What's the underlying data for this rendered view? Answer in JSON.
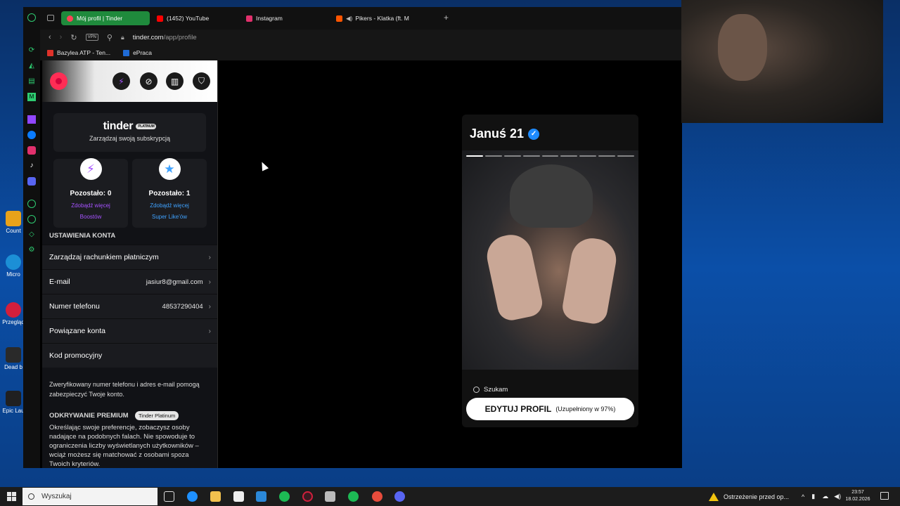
{
  "browser": {
    "tabs": [
      {
        "label": "Mój profil | Tinder",
        "active": true,
        "icon": "tinder-flame-icon",
        "color": "#ff4458"
      },
      {
        "label": "(1452) YouTube",
        "active": false,
        "icon": "youtube-icon",
        "color": "#ff0000"
      },
      {
        "label": "Instagram",
        "active": false,
        "icon": "instagram-icon",
        "color": "#e1306c"
      },
      {
        "label": "Pikers - Klatka (ft. M",
        "active": false,
        "icon": "soundcloud-icon",
        "color": "#ff5500"
      }
    ],
    "vpn_label": "VPN",
    "url_host": "tinder.com",
    "url_path": "/app/profile",
    "bookmarks": [
      {
        "label": "Bazylea ATP - Ten...",
        "icon": "bazylea-icon",
        "color": "#e0322a"
      },
      {
        "label": "ePraca",
        "icon": "epraca-icon",
        "color": "#1f6bd6"
      }
    ]
  },
  "tinder": {
    "logo_text": "tinder",
    "platinum_badge": "PLATINUM",
    "manage_subscription": "Zarządzaj swoją subskrypcją",
    "boosts": {
      "remaining": "Pozostało: 0",
      "link1": "Zdobądź więcej",
      "link2": "Boostów",
      "color": "#a652ff"
    },
    "superlikes": {
      "remaining": "Pozostało: 1",
      "link1": "Zdobądź więcej",
      "link2": "Super Like'ów",
      "color": "#3fa2ff"
    },
    "section_title": "USTAWIENIA KONTA",
    "rows": [
      {
        "label": "Zarządzaj rachunkiem płatniczym",
        "value": ""
      },
      {
        "label": "E-mail",
        "value": "jasiur8@gmail.com"
      },
      {
        "label": "Numer telefonu",
        "value": "48537290404"
      },
      {
        "label": "Powiązane konta",
        "value": ""
      },
      {
        "label": "Kod promocyjny",
        "value": ""
      }
    ],
    "note": "Zweryfikowany numer telefonu i adres e-mail pomogą zabezpieczyć Twoje konto.",
    "premium_title": "ODKRYWANIE PREMIUM",
    "premium_badge": "Tinder Platinum",
    "premium_text": "Określając swoje preferencje, zobaczysz osoby nadające na podobnych falach. Nie spowoduje to ograniczenia liczby wyświetlanych użytkowników – wciąż możesz się matchować z osobami spoza Twoich kryteriów."
  },
  "profile": {
    "name_age": "Januś 21",
    "photo_count": 9,
    "active_photo": 1,
    "seeking_label": "Szukam",
    "edit_label": "EDYTUJ PROFIL",
    "edit_completion": "(Uzupełniony w 97%)"
  },
  "taskbar": {
    "search_placeholder": "Wyszukaj",
    "warning": "Ostrzeżenie przed op...",
    "time": "23:57",
    "date": "18.02.2026"
  },
  "desktop_icons": [
    "Count",
    "Micro",
    "Przegląd",
    "Dead b",
    "Epic Lau"
  ]
}
